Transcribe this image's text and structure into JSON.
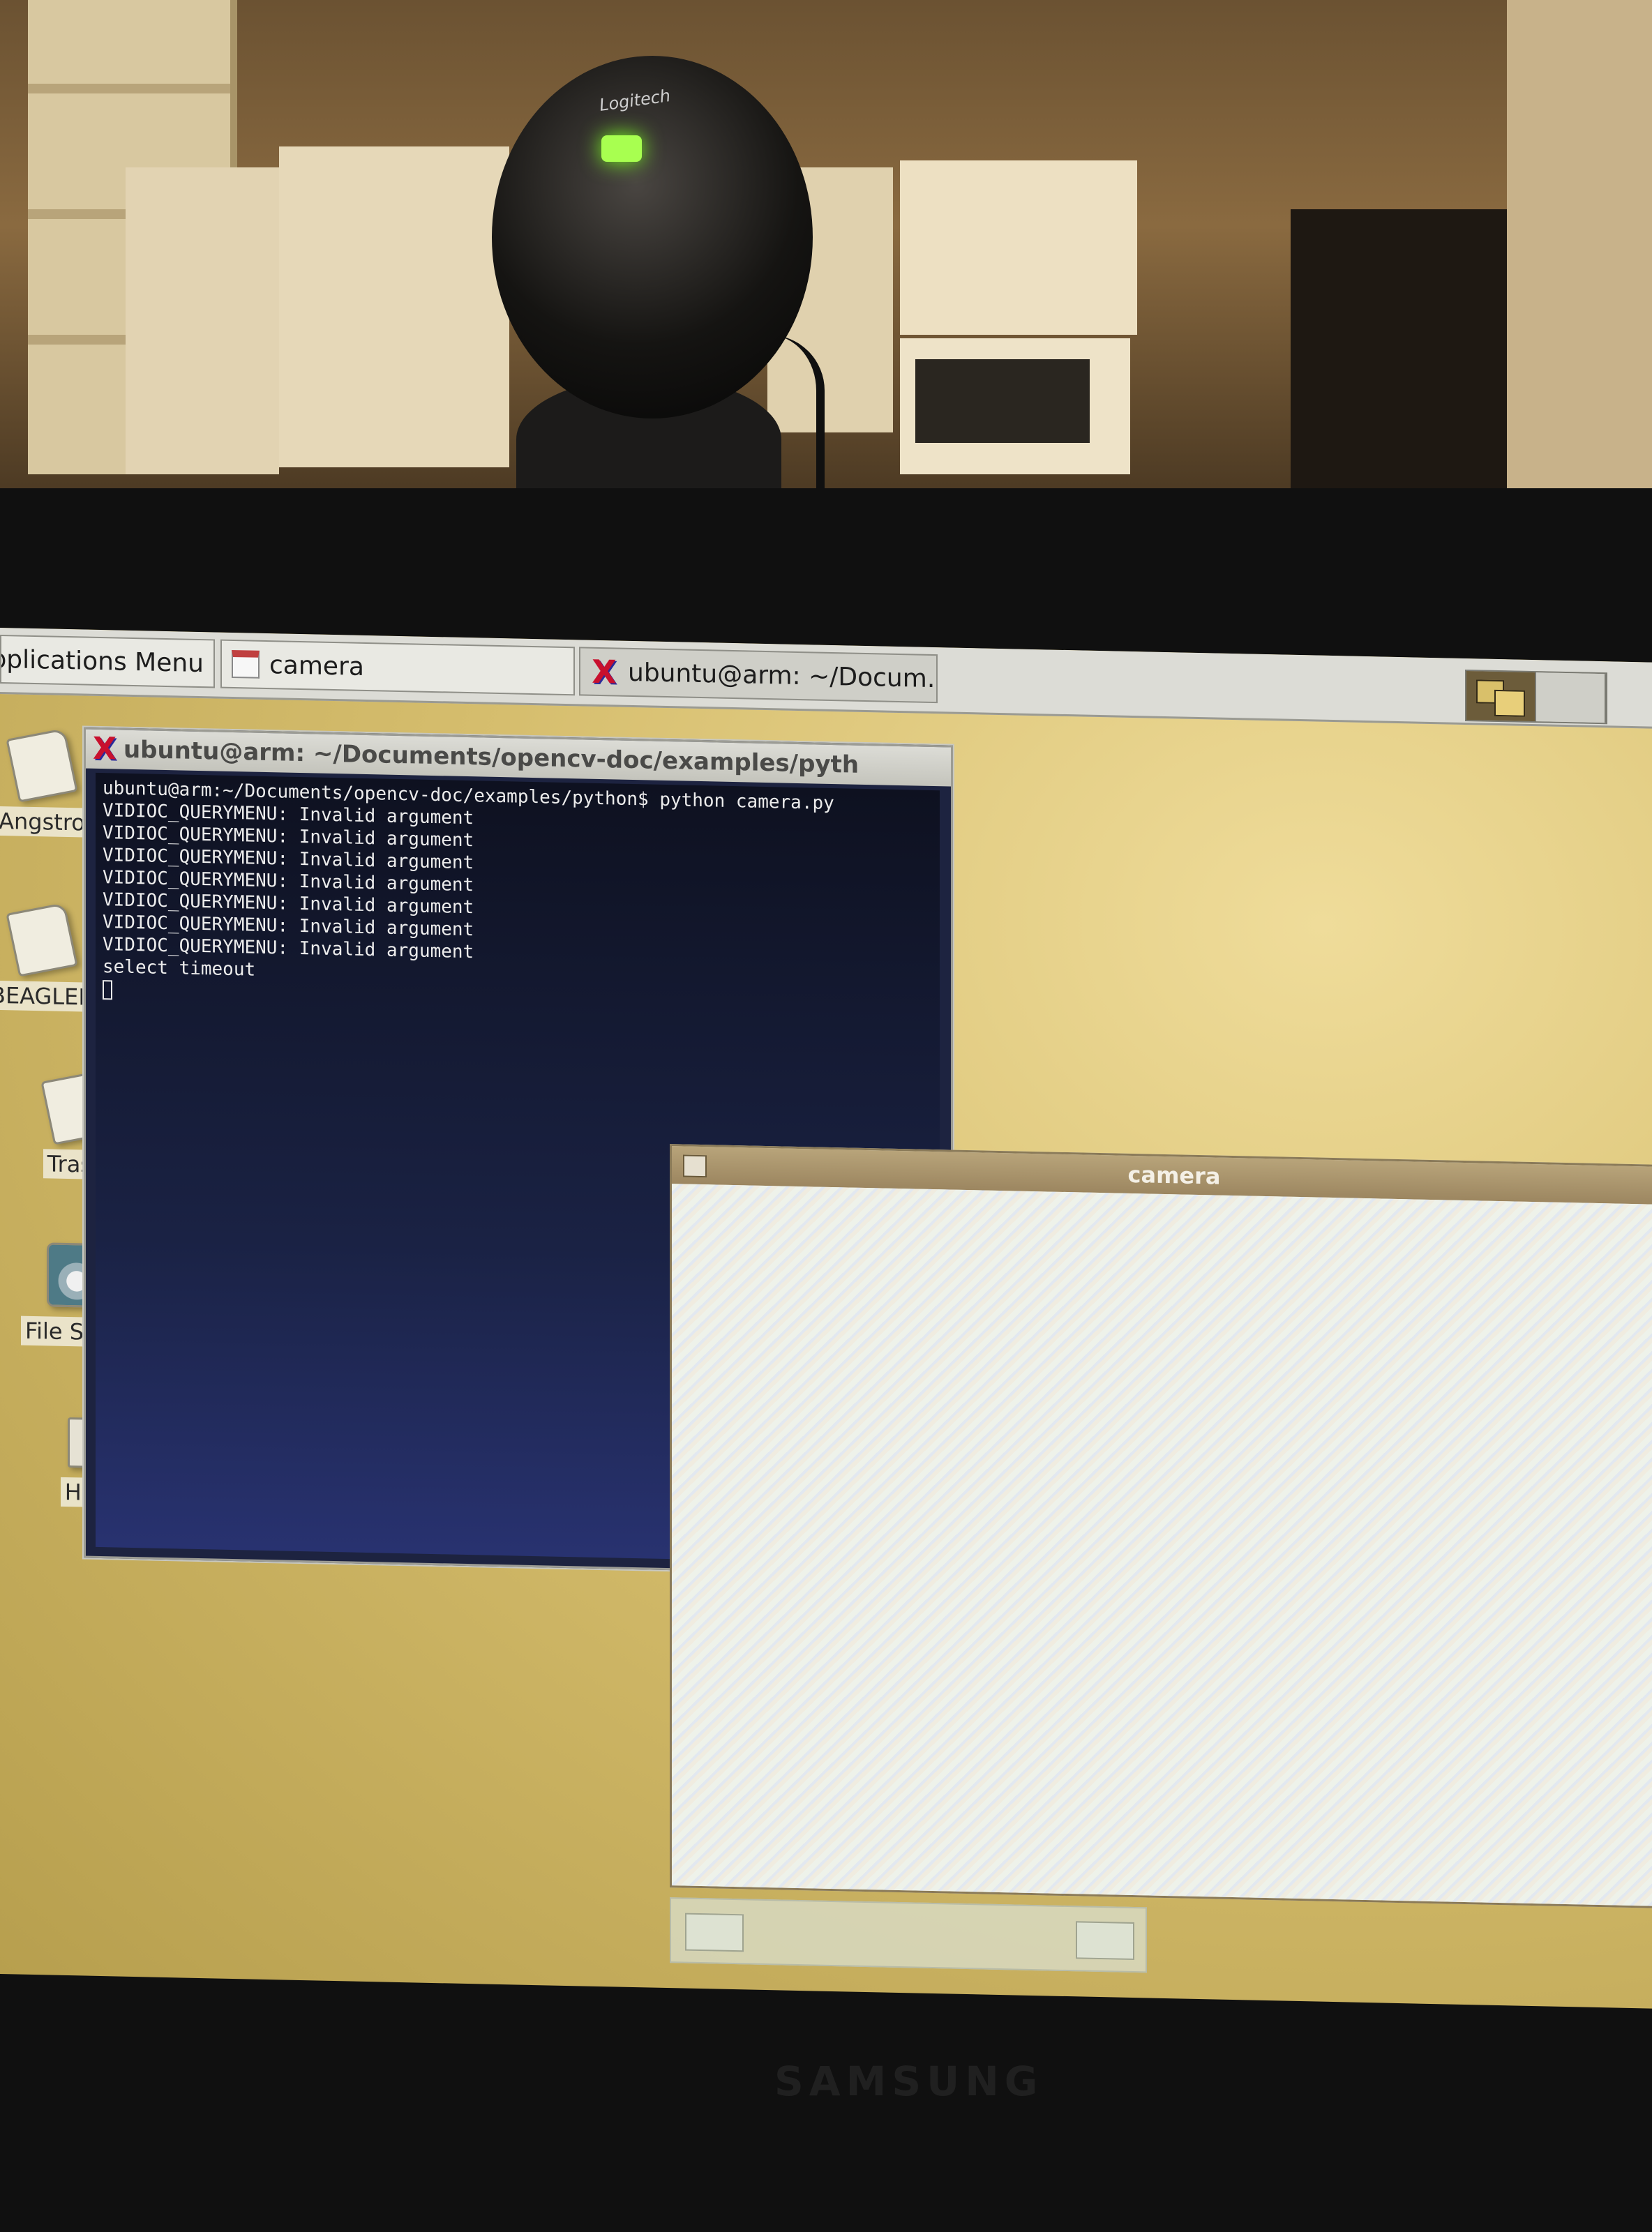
{
  "environment": {
    "webcam_brand": "Logitech",
    "monitor_brand": "SAMSUNG"
  },
  "panel": {
    "applications_menu_label": "Applications Menu",
    "tasks": [
      {
        "label": "camera",
        "icon": "calendar-window-icon"
      },
      {
        "label": "ubuntu@arm: ~/Docum...",
        "icon": "x-terminal-icon"
      }
    ],
    "workspaces": [
      "workspace-1",
      "workspace-2"
    ]
  },
  "desktop_icons": [
    {
      "label": "Angstro",
      "icon": "file-icon"
    },
    {
      "label": "BEAGLEBO",
      "icon": "file-icon"
    },
    {
      "label": "Trash",
      "icon": "trash-icon"
    },
    {
      "label": "File Syste",
      "icon": "drive-icon"
    },
    {
      "label": "Home",
      "icon": "folder-icon"
    }
  ],
  "terminal": {
    "title": "ubuntu@arm: ~/Documents/opencv-doc/examples/pyth",
    "lines": [
      "ubuntu@arm:~/Documents/opencv-doc/examples/python$ python camera.py",
      "VIDIOC_QUERYMENU: Invalid argument",
      "VIDIOC_QUERYMENU: Invalid argument",
      "VIDIOC_QUERYMENU: Invalid argument",
      "VIDIOC_QUERYMENU: Invalid argument",
      "VIDIOC_QUERYMENU: Invalid argument",
      "VIDIOC_QUERYMENU: Invalid argument",
      "VIDIOC_QUERYMENU: Invalid argument",
      "select timeout"
    ]
  },
  "camera_window": {
    "title": "camera"
  },
  "colors": {
    "desktop": "#d6be6e",
    "terminal_bg": "#1a2244",
    "panel": "#dcdcd6",
    "accent_x": "#c8102e"
  }
}
